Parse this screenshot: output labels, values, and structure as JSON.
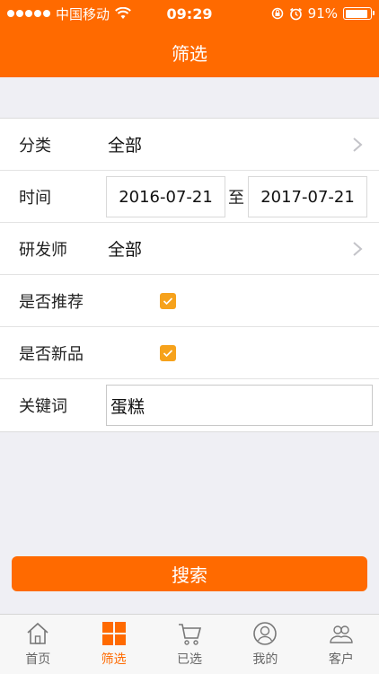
{
  "status": {
    "carrier": "中国移动",
    "time": "09:29",
    "battery": "91%",
    "battery_level": 0.91
  },
  "nav": {
    "title": "筛选"
  },
  "form": {
    "category": {
      "label": "分类",
      "value": "全部"
    },
    "time": {
      "label": "时间",
      "start": "2016-07-21",
      "separator": "至",
      "end": "2017-07-21"
    },
    "developer": {
      "label": "研发师",
      "value": "全部"
    },
    "recommended": {
      "label": "是否推荐",
      "checked": true
    },
    "new_product": {
      "label": "是否新品",
      "checked": true
    },
    "keyword": {
      "label": "关键词",
      "value": "蛋糕"
    }
  },
  "search_button": {
    "label": "搜索"
  },
  "tabs": [
    {
      "label": "首页",
      "icon": "home-icon",
      "active": false
    },
    {
      "label": "筛选",
      "icon": "grid-icon",
      "active": true
    },
    {
      "label": "已选",
      "icon": "cart-icon",
      "active": false
    },
    {
      "label": "我的",
      "icon": "user-icon",
      "active": false
    },
    {
      "label": "客户",
      "icon": "customers-icon",
      "active": false
    }
  ],
  "colors": {
    "accent": "#ff6a00",
    "checkbox": "#f6a21c",
    "background": "#efeff4"
  }
}
